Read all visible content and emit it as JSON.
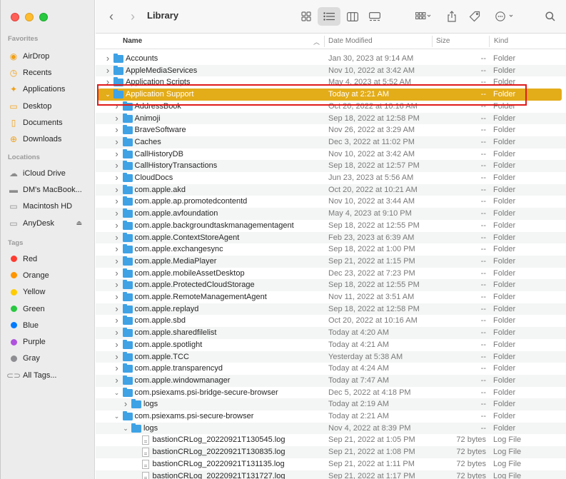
{
  "window": {
    "title": "Library"
  },
  "toolbar": {
    "back": "chevron-left-icon",
    "forward": "chevron-right-icon",
    "title": "Library",
    "views": [
      "icon-view-icon",
      "list-view-icon",
      "column-view-icon",
      "gallery-view-icon"
    ],
    "actions": [
      "group-icon",
      "share-icon",
      "tag-icon",
      "more-icon",
      "search-icon"
    ]
  },
  "sidebar": {
    "favorites_title": "Favorites",
    "favorites": [
      {
        "label": "AirDrop",
        "icon": "airdrop-icon"
      },
      {
        "label": "Recents",
        "icon": "clock-icon"
      },
      {
        "label": "Applications",
        "icon": "applications-icon"
      },
      {
        "label": "Desktop",
        "icon": "desktop-icon"
      },
      {
        "label": "Documents",
        "icon": "document-icon"
      },
      {
        "label": "Downloads",
        "icon": "download-icon"
      }
    ],
    "locations_title": "Locations",
    "locations": [
      {
        "label": "iCloud Drive",
        "icon": "cloud-icon"
      },
      {
        "label": "DM's MacBook...",
        "icon": "laptop-icon"
      },
      {
        "label": "Macintosh HD",
        "icon": "disk-icon"
      },
      {
        "label": "AnyDesk",
        "icon": "disk-icon"
      }
    ],
    "tags_title": "Tags",
    "tags": [
      {
        "label": "Red",
        "color": "#ff3b30"
      },
      {
        "label": "Orange",
        "color": "#ff9500"
      },
      {
        "label": "Yellow",
        "color": "#ffcc00"
      },
      {
        "label": "Green",
        "color": "#28c840"
      },
      {
        "label": "Blue",
        "color": "#007aff"
      },
      {
        "label": "Purple",
        "color": "#af52de"
      },
      {
        "label": "Gray",
        "color": "#8e8e93"
      },
      {
        "label": "All Tags...",
        "color": ""
      }
    ]
  },
  "columns": {
    "name": "Name",
    "date": "Date Modified",
    "size": "Size",
    "kind": "Kind"
  },
  "accent_color": "#e3ac19",
  "rows": [
    {
      "name": "Accounts",
      "date": "Jan 30, 2023 at 9:14 AM",
      "size": "--",
      "kind": "Folder"
    },
    {
      "name": "AppleMediaServices",
      "date": "Nov 10, 2022 at 3:42 AM",
      "size": "--",
      "kind": "Folder"
    },
    {
      "name": "Application Scripts",
      "date": "May 4, 2023 at 5:52 AM",
      "size": "--",
      "kind": "Folder"
    },
    {
      "name": "Application Support",
      "date": "Today at 2:21 AM",
      "size": "--",
      "kind": "Folder"
    },
    {
      "name": "AddressBook",
      "date": "Oct 20, 2022 at 10:16 AM",
      "size": "--",
      "kind": "Folder"
    },
    {
      "name": "Animoji",
      "date": "Sep 18, 2022 at 12:58 PM",
      "size": "--",
      "kind": "Folder"
    },
    {
      "name": "BraveSoftware",
      "date": "Nov 26, 2022 at 3:29 AM",
      "size": "--",
      "kind": "Folder"
    },
    {
      "name": "Caches",
      "date": "Dec 3, 2022 at 11:02 PM",
      "size": "--",
      "kind": "Folder"
    },
    {
      "name": "CallHistoryDB",
      "date": "Nov 10, 2022 at 3:42 AM",
      "size": "--",
      "kind": "Folder"
    },
    {
      "name": "CallHistoryTransactions",
      "date": "Sep 18, 2022 at 12:57 PM",
      "size": "--",
      "kind": "Folder"
    },
    {
      "name": "CloudDocs",
      "date": "Jun 23, 2023 at 5:56 AM",
      "size": "--",
      "kind": "Folder"
    },
    {
      "name": "com.apple.akd",
      "date": "Oct 20, 2022 at 10:21 AM",
      "size": "--",
      "kind": "Folder"
    },
    {
      "name": "com.apple.ap.promotedcontentd",
      "date": "Nov 10, 2022 at 3:44 AM",
      "size": "--",
      "kind": "Folder"
    },
    {
      "name": "com.apple.avfoundation",
      "date": "May 4, 2023 at 9:10 PM",
      "size": "--",
      "kind": "Folder"
    },
    {
      "name": "com.apple.backgroundtaskmanagementagent",
      "date": "Sep 18, 2022 at 12:55 PM",
      "size": "--",
      "kind": "Folder"
    },
    {
      "name": "com.apple.ContextStoreAgent",
      "date": "Feb 23, 2023 at 6:39 AM",
      "size": "--",
      "kind": "Folder"
    },
    {
      "name": "com.apple.exchangesync",
      "date": "Sep 18, 2022 at 1:00 PM",
      "size": "--",
      "kind": "Folder"
    },
    {
      "name": "com.apple.MediaPlayer",
      "date": "Sep 21, 2022 at 1:15 PM",
      "size": "--",
      "kind": "Folder"
    },
    {
      "name": "com.apple.mobileAssetDesktop",
      "date": "Dec 23, 2022 at 7:23 PM",
      "size": "--",
      "kind": "Folder"
    },
    {
      "name": "com.apple.ProtectedCloudStorage",
      "date": "Sep 18, 2022 at 12:55 PM",
      "size": "--",
      "kind": "Folder"
    },
    {
      "name": "com.apple.RemoteManagementAgent",
      "date": "Nov 11, 2022 at 3:51 AM",
      "size": "--",
      "kind": "Folder"
    },
    {
      "name": "com.apple.replayd",
      "date": "Sep 18, 2022 at 12:58 PM",
      "size": "--",
      "kind": "Folder"
    },
    {
      "name": "com.apple.sbd",
      "date": "Oct 20, 2022 at 10:16 AM",
      "size": "--",
      "kind": "Folder"
    },
    {
      "name": "com.apple.sharedfilelist",
      "date": "Today at 4:20 AM",
      "size": "--",
      "kind": "Folder"
    },
    {
      "name": "com.apple.spotlight",
      "date": "Today at 4:21 AM",
      "size": "--",
      "kind": "Folder"
    },
    {
      "name": "com.apple.TCC",
      "date": "Yesterday at 5:38 AM",
      "size": "--",
      "kind": "Folder"
    },
    {
      "name": "com.apple.transparencyd",
      "date": "Today at 4:24 AM",
      "size": "--",
      "kind": "Folder"
    },
    {
      "name": "com.apple.windowmanager",
      "date": "Today at 7:47 AM",
      "size": "--",
      "kind": "Folder"
    },
    {
      "name": "com.psiexams.psi-bridge-secure-browser",
      "date": "Dec 5, 2022 at 4:18 PM",
      "size": "--",
      "kind": "Folder"
    },
    {
      "name": "logs",
      "date": "Today at 2:19 AM",
      "size": "--",
      "kind": "Folder"
    },
    {
      "name": "com.psiexams.psi-secure-browser",
      "date": "Today at 2:21 AM",
      "size": "--",
      "kind": "Folder"
    },
    {
      "name": "logs",
      "date": "Nov 4, 2022 at 8:39 PM",
      "size": "--",
      "kind": "Folder"
    },
    {
      "name": "bastionCRLog_20220921T130545.log",
      "date": "Sep 21, 2022 at 1:05 PM",
      "size": "72 bytes",
      "kind": "Log File"
    },
    {
      "name": "bastionCRLog_20220921T130835.log",
      "date": "Sep 21, 2022 at 1:08 PM",
      "size": "72 bytes",
      "kind": "Log File"
    },
    {
      "name": "bastionCRLog_20220921T131135.log",
      "date": "Sep 21, 2022 at 1:11 PM",
      "size": "72 bytes",
      "kind": "Log File"
    },
    {
      "name": "bastionCRLog_20220921T131727.log",
      "date": "Sep 21, 2022 at 1:17 PM",
      "size": "72 bytes",
      "kind": "Log File"
    }
  ]
}
